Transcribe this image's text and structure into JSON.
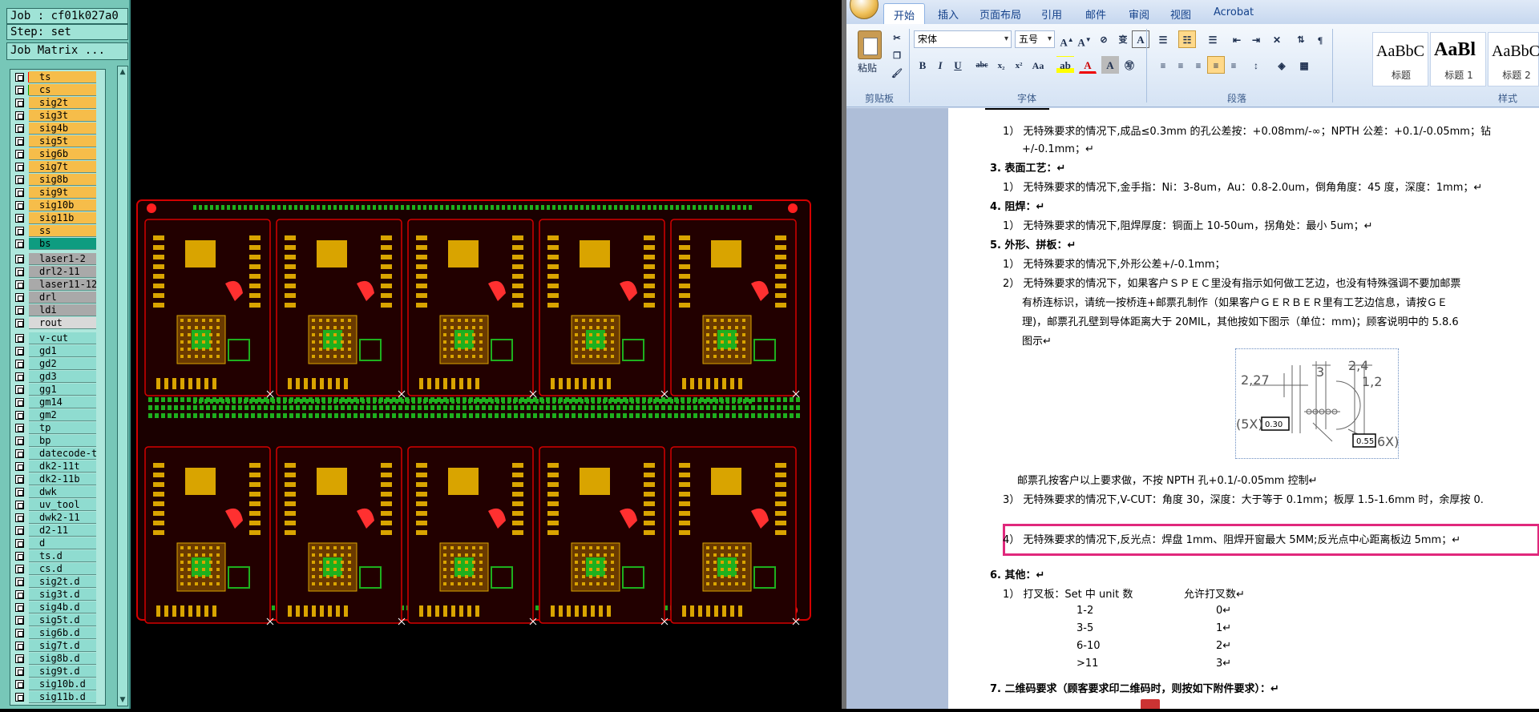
{
  "cam": {
    "job": "Job : cf01k027a0",
    "step": "Step: set",
    "matrix_button": "Job Matrix ...",
    "layers": [
      {
        "name": "ts",
        "color": "#f6bd4a",
        "swatch": "#ff0000"
      },
      {
        "name": "cs",
        "color": "#f6bd4a",
        "swatch": "#00a000"
      },
      {
        "name": "sig2t",
        "color": "#f6bd4a"
      },
      {
        "name": "sig3t",
        "color": "#f6bd4a"
      },
      {
        "name": "sig4b",
        "color": "#f6bd4a"
      },
      {
        "name": "sig5t",
        "color": "#f6bd4a"
      },
      {
        "name": "sig6b",
        "color": "#f6bd4a"
      },
      {
        "name": "sig7t",
        "color": "#f6bd4a"
      },
      {
        "name": "sig8b",
        "color": "#f6bd4a"
      },
      {
        "name": "sig9t",
        "color": "#f6bd4a"
      },
      {
        "name": "sig10b",
        "color": "#f6bd4a"
      },
      {
        "name": "sig11b",
        "color": "#f6bd4a"
      },
      {
        "name": "ss",
        "color": "#f6bd4a"
      },
      {
        "name": "bs",
        "color": "#0e9c80"
      },
      {
        "name": "laser1-2",
        "color": "#a9a9a9"
      },
      {
        "name": "drl2-11",
        "color": "#a9a9a9"
      },
      {
        "name": "laser11-12",
        "color": "#a9a9a9"
      },
      {
        "name": "drl",
        "color": "#a9a9a9"
      },
      {
        "name": "ldi",
        "color": "#a9a9a9"
      },
      {
        "name": "rout",
        "color": "#d9d9d9"
      },
      {
        "name": "v-cut",
        "color": "#8fdcd0"
      },
      {
        "name": "gd1",
        "color": "#8fdcd0"
      },
      {
        "name": "gd2",
        "color": "#8fdcd0"
      },
      {
        "name": "gd3",
        "color": "#8fdcd0"
      },
      {
        "name": "gg1",
        "color": "#8fdcd0"
      },
      {
        "name": "gm14",
        "color": "#8fdcd0"
      },
      {
        "name": "gm2",
        "color": "#8fdcd0"
      },
      {
        "name": "tp",
        "color": "#8fdcd0"
      },
      {
        "name": "bp",
        "color": "#8fdcd0"
      },
      {
        "name": "datecode-ts",
        "color": "#8fdcd0"
      },
      {
        "name": "dk2-11t",
        "color": "#8fdcd0"
      },
      {
        "name": "dk2-11b",
        "color": "#8fdcd0"
      },
      {
        "name": "dwk",
        "color": "#8fdcd0"
      },
      {
        "name": "uv_tool",
        "color": "#8fdcd0"
      },
      {
        "name": "dwk2-11",
        "color": "#8fdcd0"
      },
      {
        "name": "d2-11",
        "color": "#8fdcd0"
      },
      {
        "name": "d",
        "color": "#8fdcd0"
      },
      {
        "name": "ts.d",
        "color": "#8fdcd0"
      },
      {
        "name": "cs.d",
        "color": "#8fdcd0"
      },
      {
        "name": "sig2t.d",
        "color": "#8fdcd0"
      },
      {
        "name": "sig3t.d",
        "color": "#8fdcd0"
      },
      {
        "name": "sig4b.d",
        "color": "#8fdcd0"
      },
      {
        "name": "sig5t.d",
        "color": "#8fdcd0"
      },
      {
        "name": "sig6b.d",
        "color": "#8fdcd0"
      },
      {
        "name": "sig7t.d",
        "color": "#8fdcd0"
      },
      {
        "name": "sig8b.d",
        "color": "#8fdcd0"
      },
      {
        "name": "sig9t.d",
        "color": "#8fdcd0"
      },
      {
        "name": "sig10b.d",
        "color": "#8fdcd0"
      },
      {
        "name": "sig11b.d",
        "color": "#8fdcd0"
      }
    ],
    "panel": {
      "rows": 2,
      "cols": 5,
      "board_color": "#d40000",
      "copper_color": "#d9a400",
      "pad_color": "#1eb01e"
    }
  },
  "word": {
    "tabs": [
      "开始",
      "插入",
      "页面布局",
      "引用",
      "邮件",
      "审阅",
      "视图",
      "Acrobat"
    ],
    "clipboard": {
      "paste": "粘贴",
      "group": "剪贴板"
    },
    "font": {
      "name": "宋体",
      "size": "五号",
      "group": "字体"
    },
    "paragraph_group": "段落",
    "styles": [
      {
        "sample": "AaBbC",
        "name": "标题"
      },
      {
        "sample": "AaBl",
        "name": "标题 1"
      },
      {
        "sample": "AaBbC",
        "name": "标题 2"
      }
    ],
    "styles_group": "样式",
    "doc": {
      "l1": "1） 无特殊要求的情况下,成品≤0.3mm 的孔公差按：+0.08mm/-∞；NPTH 公差：+0.1/-0.05mm；钻",
      "l2": "+/-0.1mm；↵",
      "h3": "3.  表面工艺：↵",
      "l3": "1） 无特殊要求的情况下,金手指：Ni：3-8um，Au：0.8-2.0um，倒角角度：45 度，深度：1mm；↵",
      "h4": "4.  阻焊：↵",
      "l4": "1） 无特殊要求的情况下,阻焊厚度：铜面上 10-50um，拐角处：最小 5um；↵",
      "h5": "5.  外形、拼板：↵",
      "l5": "1） 无特殊要求的情况下,外形公差+/-0.1mm；",
      "l6": "2） 无特殊要求的情况下，如果客户ＳＰＥＣ里没有指示如何做工艺边，也没有特殊强调不要加邮票",
      "l7": "有桥连标识，请统一按桥连+邮票孔制作（如果客户ＧＥＲＢＥＲ里有工艺边信息，请按ＧＥ",
      "l8": "理)，邮票孔孔壁到导体距离大于 20MIL，其他按如下图示（单位：mm)；顾客说明中的 5.8.6",
      "l9": "图示↵",
      "fig": {
        "d1": "2,27",
        "d2": "3",
        "d3": "2,4",
        "d4": "1,2",
        "d5": "0.30",
        "d6": "(5X)",
        "d7": "0.55",
        "d8": "6X)"
      },
      "l10": "邮票孔按客户以上要求做，不按 NPTH 孔+0.1/-0.05mm 控制↵",
      "l11": "3） 无特殊要求的情况下,V-CUT：角度 30，深度：大于等于 0.1mm；板厚 1.5-1.6mm 时，余厚按 0.",
      "l12": "4） 无特殊要求的情况下,反光点：焊盘 1mm、阻焊开窗最大 5MM;反光点中心距离板边 5mm；↵",
      "h6": "6.  其他：↵",
      "l13": "1） 打叉板：Set 中 unit 数",
      "l13b": "允许打叉数↵",
      "table": [
        {
          "a": "1-2",
          "b": "0↵"
        },
        {
          "a": "3-5",
          "b": "1↵"
        },
        {
          "a": "6-10",
          "b": "2↵"
        },
        {
          "a": ">11",
          "b": "3↵"
        }
      ],
      "h7": "7. 二维码要求（顾客要求印二维码时，则按如下附件要求）：↵"
    }
  }
}
